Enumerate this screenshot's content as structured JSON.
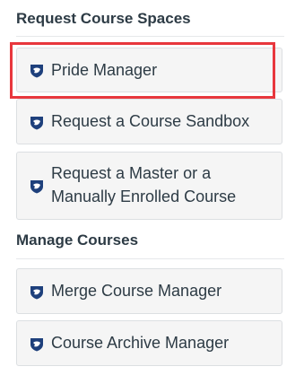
{
  "sections": {
    "request": {
      "heading": "Request Course Spaces",
      "items": [
        {
          "label": "Pride Manager",
          "icon": "psu-shield-icon"
        },
        {
          "label": "Request a Course Sandbox",
          "icon": "psu-shield-icon"
        },
        {
          "label": "Request a Master or a Manually Enrolled Course",
          "icon": "psu-shield-icon"
        }
      ]
    },
    "manage": {
      "heading": "Manage Courses",
      "items": [
        {
          "label": "Merge Course Manager",
          "icon": "psu-shield-icon"
        },
        {
          "label": "Course Archive Manager",
          "icon": "psu-shield-icon"
        }
      ]
    }
  },
  "colors": {
    "icon_blue": "#1e407c",
    "highlight": "#e8373d",
    "card_bg": "#f5f5f5",
    "text": "#2d3b45"
  }
}
